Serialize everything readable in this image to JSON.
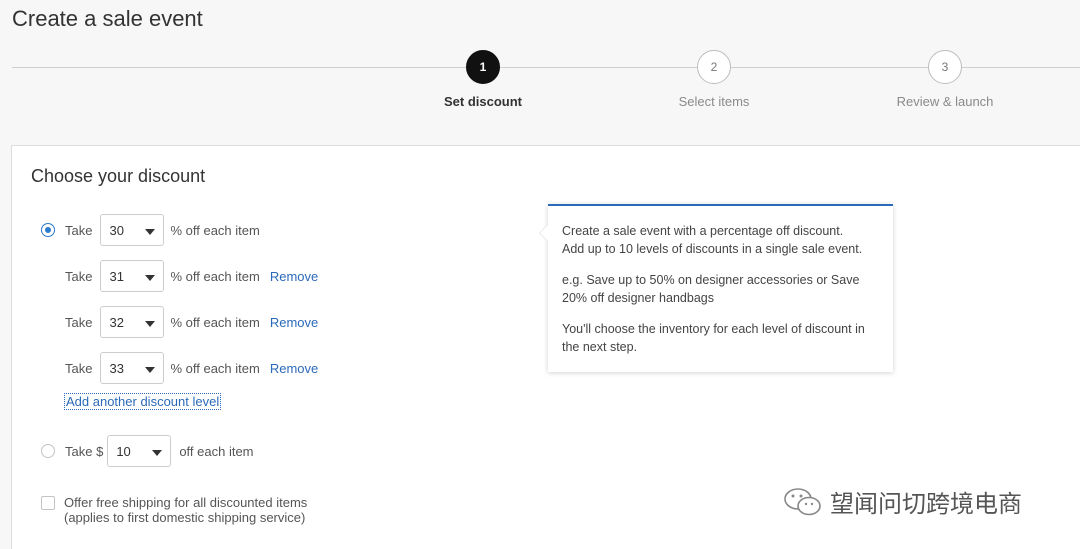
{
  "page": {
    "title": "Create a sale event"
  },
  "steps": [
    {
      "number": "1",
      "label": "Set discount",
      "active": true
    },
    {
      "number": "2",
      "label": "Select items",
      "active": false
    },
    {
      "number": "3",
      "label": "Review & launch",
      "active": false
    }
  ],
  "card": {
    "title": "Choose your discount"
  },
  "percent_option": {
    "take_label": "Take",
    "suffix": "% off each item",
    "remove_label": "Remove",
    "levels": [
      "30",
      "31",
      "32",
      "33"
    ],
    "add_level_label": "Add another discount level"
  },
  "dollar_option": {
    "take_label": "Take $",
    "value": "10",
    "suffix": "off each item"
  },
  "shipping": {
    "line1": "Offer free shipping for all discounted items",
    "line2": "(applies to first domestic shipping service)"
  },
  "tooltip": {
    "p1_line1": "Create a sale event with a percentage off discount.",
    "p1_line2": "Add up to 10 levels of discounts in a single sale event.",
    "p2_line1": "e.g. Save up to 50% on designer accessories or Save",
    "p2_line2": "20% off designer handbags",
    "p3_line1": "You'll choose the inventory for each level of discount in",
    "p3_line2": "the next step."
  },
  "watermark": {
    "text": "望闻问切跨境电商"
  },
  "colors": {
    "accent": "#2b6ab8",
    "active_step": "#111111"
  }
}
